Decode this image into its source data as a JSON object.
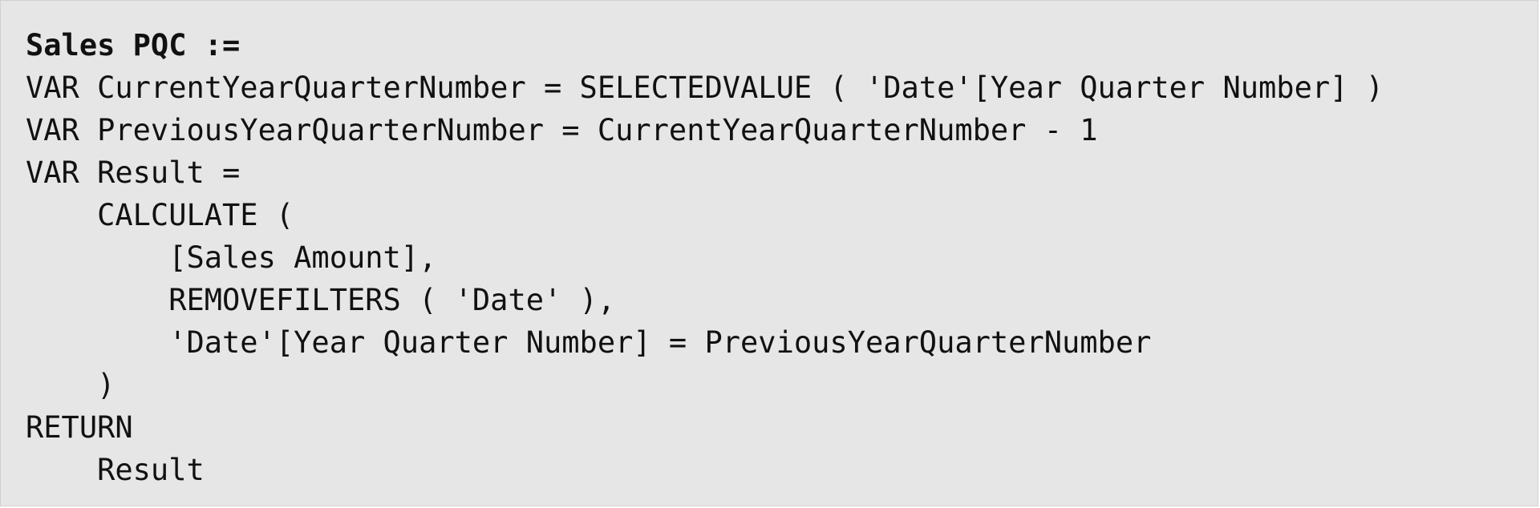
{
  "code": {
    "lines": [
      "Sales PQC :=",
      "VAR CurrentYearQuarterNumber = SELECTEDVALUE ( 'Date'[Year Quarter Number] )",
      "VAR PreviousYearQuarterNumber = CurrentYearQuarterNumber - 1",
      "VAR Result =",
      "    CALCULATE (",
      "        [Sales Amount],",
      "        REMOVEFILTERS ( 'Date' ),",
      "        'Date'[Year Quarter Number] = PreviousYearQuarterNumber",
      "    )",
      "RETURN",
      "    Result"
    ]
  }
}
